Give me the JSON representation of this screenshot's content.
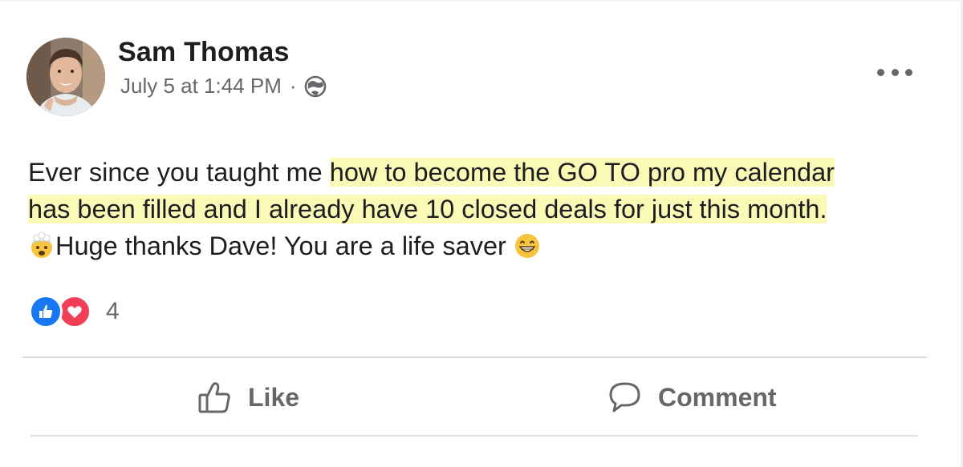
{
  "post": {
    "author": "Sam Thomas",
    "timestamp": "July 5 at 1:44 PM",
    "separator": "·",
    "privacy_icon": "globe-icon",
    "more_icon": "more-options-icon",
    "text": {
      "before_highlight": "Ever since you taught me ",
      "highlight_line1": "how to become the GO TO pro my calendar",
      "highlight_line2": "has been filled and I already have 10 closed deals for just this month.",
      "after_emoji1": "Huge thanks Dave! You are a life saver ",
      "emoji1": "exploding-head-emoji",
      "emoji2": "grinning-face-emoji",
      "highlight_color": "#fbf9b6"
    },
    "reactions": {
      "types": [
        "like-reaction-icon",
        "love-reaction-icon"
      ],
      "count": "4",
      "like_color": "#1877f2",
      "love_color": "#f33e58"
    },
    "actions": {
      "like_label": "Like",
      "comment_label": "Comment"
    }
  }
}
